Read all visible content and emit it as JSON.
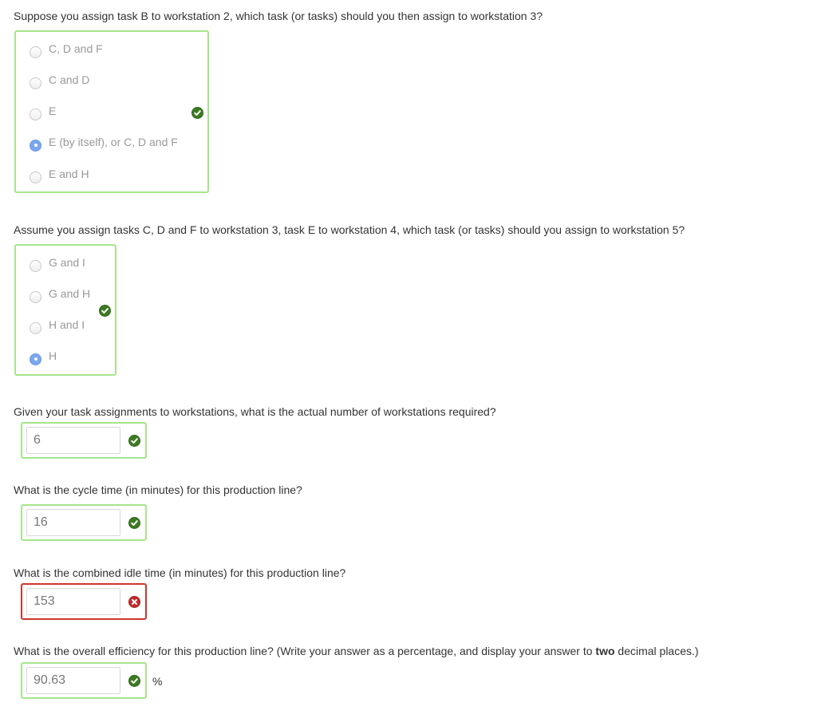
{
  "q1": {
    "text": "Suppose you assign task B to workstation 2, which task (or tasks) should you then assign to workstation 3?",
    "options": [
      "C, D and F",
      "C and D",
      "E",
      "E (by itself), or C, D and F",
      "E and H"
    ],
    "selected": "E (by itself), or C, D and F",
    "status": "correct"
  },
  "q2": {
    "text": "Assume you assign tasks C, D and F to workstation 3, task E to workstation 4, which task (or tasks) should you assign to workstation 5?",
    "options": [
      "G and I",
      "G and H",
      "H and I",
      "H"
    ],
    "selected": "H",
    "status": "correct"
  },
  "q3": {
    "text": "Given your task assignments to workstations, what is the actual number of workstations required?",
    "value": "6",
    "status": "correct"
  },
  "q4": {
    "text": "What is the cycle time (in minutes) for this production line?",
    "value": "16",
    "status": "correct"
  },
  "q5": {
    "text": "What is the combined idle time (in minutes) for this production line?",
    "value": "153",
    "status": "incorrect"
  },
  "q6": {
    "text_before": "What is the overall efficiency for this production line? (Write your answer as a percentage, and display your answer to ",
    "text_bold": "two",
    "text_after": " decimal places.)",
    "value": "90.63",
    "unit": "%",
    "status": "correct"
  },
  "colors": {
    "correct_border": "#a6e58a",
    "incorrect_border": "#d0342c",
    "correct_icon": "#3d7a22",
    "incorrect_icon": "#c42b2b",
    "radio_selected": "#7aa7f0"
  }
}
